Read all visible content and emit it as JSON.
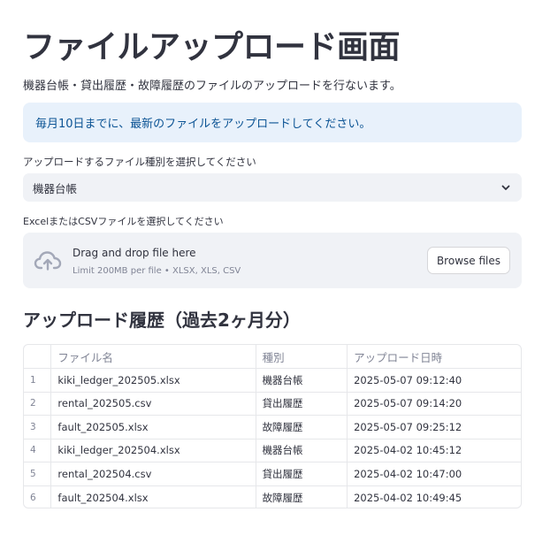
{
  "title": "ファイルアップロード画面",
  "subtitle": "機器台帳・貸出履歴・故障履歴のファイルのアップロードを行ないます。",
  "info_message": "毎月10日までに、最新のファイルをアップロードしてください。",
  "file_type_select": {
    "label": "アップロードするファイル種別を選択してください",
    "value": "機器台帳"
  },
  "uploader": {
    "label": "ExcelまたはCSVファイルを選択してください",
    "drop_text": "Drag and drop file here",
    "limit_text": "Limit 200MB per file • XLSX, XLS, CSV",
    "browse_label": "Browse files"
  },
  "history": {
    "heading": "アップロード履歴（過去2ヶ月分）",
    "columns": [
      "",
      "ファイル名",
      "種別",
      "アップロード日時"
    ],
    "rows": [
      [
        "1",
        "kiki_ledger_202505.xlsx",
        "機器台帳",
        "2025-05-07 09:12:40"
      ],
      [
        "2",
        "rental_202505.csv",
        "貸出履歴",
        "2025-05-07 09:14:20"
      ],
      [
        "3",
        "fault_202505.xlsx",
        "故障履歴",
        "2025-05-07 09:25:12"
      ],
      [
        "4",
        "kiki_ledger_202504.xlsx",
        "機器台帳",
        "2025-04-02 10:45:12"
      ],
      [
        "5",
        "rental_202504.csv",
        "貸出履歴",
        "2025-04-02 10:47:00"
      ],
      [
        "6",
        "fault_202504.xlsx",
        "故障履歴",
        "2025-04-02 10:49:45"
      ]
    ]
  },
  "icons": {
    "upload": "cloud-upload-icon",
    "dropdown": "chevron-down-icon"
  },
  "colors": {
    "info_bg": "#e8f1fb",
    "info_text": "#0b5394",
    "input_bg": "#f0f2f6",
    "text": "#31333f",
    "muted": "#808495"
  }
}
